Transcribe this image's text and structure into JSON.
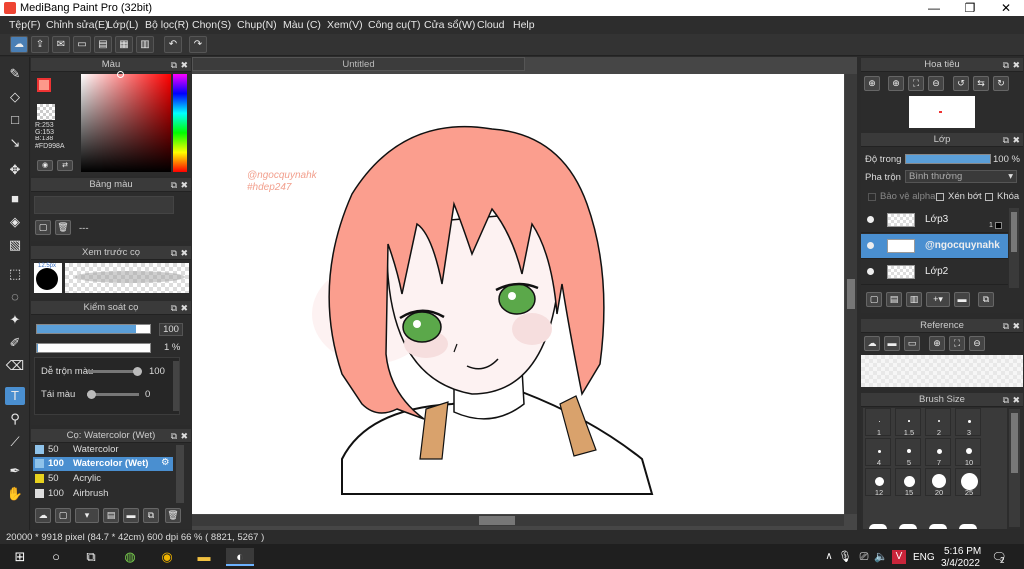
{
  "window": {
    "title": "MediBang Paint Pro (32bit)",
    "min": "—",
    "max": "❐",
    "close": "✕"
  },
  "menu": [
    "Tệp(F)",
    "Chỉnh sửa(E)",
    "Lớp(L)",
    "Bộ lọc(R)",
    "Chọn(S)",
    "Chụp(N)",
    "Màu (C)",
    "Xem(V)",
    "Công cụ(T)",
    "Cửa sổ(W)",
    "Cloud",
    "Help"
  ],
  "document": {
    "tab": "Untitled"
  },
  "color_panel": {
    "title": "Màu",
    "r": "R:253",
    "g": "G:153",
    "b": "B:138",
    "hex": "#FD998A",
    "primary": "#FD998A"
  },
  "palette_panel": {
    "title": "Bảng màu",
    "dash": "---"
  },
  "preview_panel": {
    "title": "Xem trước cọ",
    "size": "12.5px"
  },
  "brush_control": {
    "title": "Kiểm soát cọ",
    "size_value": "100",
    "opacity_value": "1 %",
    "blend_label": "Dễ trộn màu",
    "blend_value": "100",
    "refill_label": "Tái màu",
    "refill_value": "0",
    "size_fill": 0.88,
    "opacity_fill": 0.01,
    "blend_fill": 1.0,
    "refill_fill": 0.0
  },
  "brush_list": {
    "title": "Cọ: Watercolor (Wet)",
    "items": [
      {
        "size": "50",
        "name": "Watercolor",
        "color": "#8fc3ea"
      },
      {
        "size": "100",
        "name": "Watercolor (Wet)",
        "color": "#8fc3ea"
      },
      {
        "size": "50",
        "name": "Acrylic",
        "color": "#e8d21e"
      },
      {
        "size": "100",
        "name": "Airbrush",
        "color": "#dddddd"
      }
    ]
  },
  "navigator": {
    "title": "Hoa tiêu"
  },
  "layers": {
    "title": "Lớp",
    "opacity_label": "Độ trong",
    "opacity_value": "100 %",
    "blend_label": "Pha trộn",
    "blend_value": "Bình thường",
    "protect_alpha": "Bảo vệ alpha",
    "clipping": "Xén bớt",
    "lock": "Khóa",
    "items": [
      {
        "name": "Lớp3",
        "selected": false
      },
      {
        "name": "@ngocquynahk",
        "selected": true
      },
      {
        "name": "Lớp2",
        "selected": false
      }
    ]
  },
  "reference": {
    "title": "Reference"
  },
  "brush_size": {
    "title": "Brush Size",
    "sizes": [
      "1",
      "1.5",
      "2",
      "3",
      "4",
      "5",
      "7",
      "10",
      "12",
      "15",
      "20",
      "25"
    ]
  },
  "canvas_text": {
    "line1": "@ngocquynahk",
    "line2": "#hdep247"
  },
  "status": {
    "text": "20000 * 9918 pixel  (84.7 * 42cm)  600 dpi  66 %  ( 8821, 5267 )"
  },
  "taskbar": {
    "lang": "ENG",
    "time": "5:16 PM",
    "date": "3/4/2022",
    "notif": "2"
  }
}
